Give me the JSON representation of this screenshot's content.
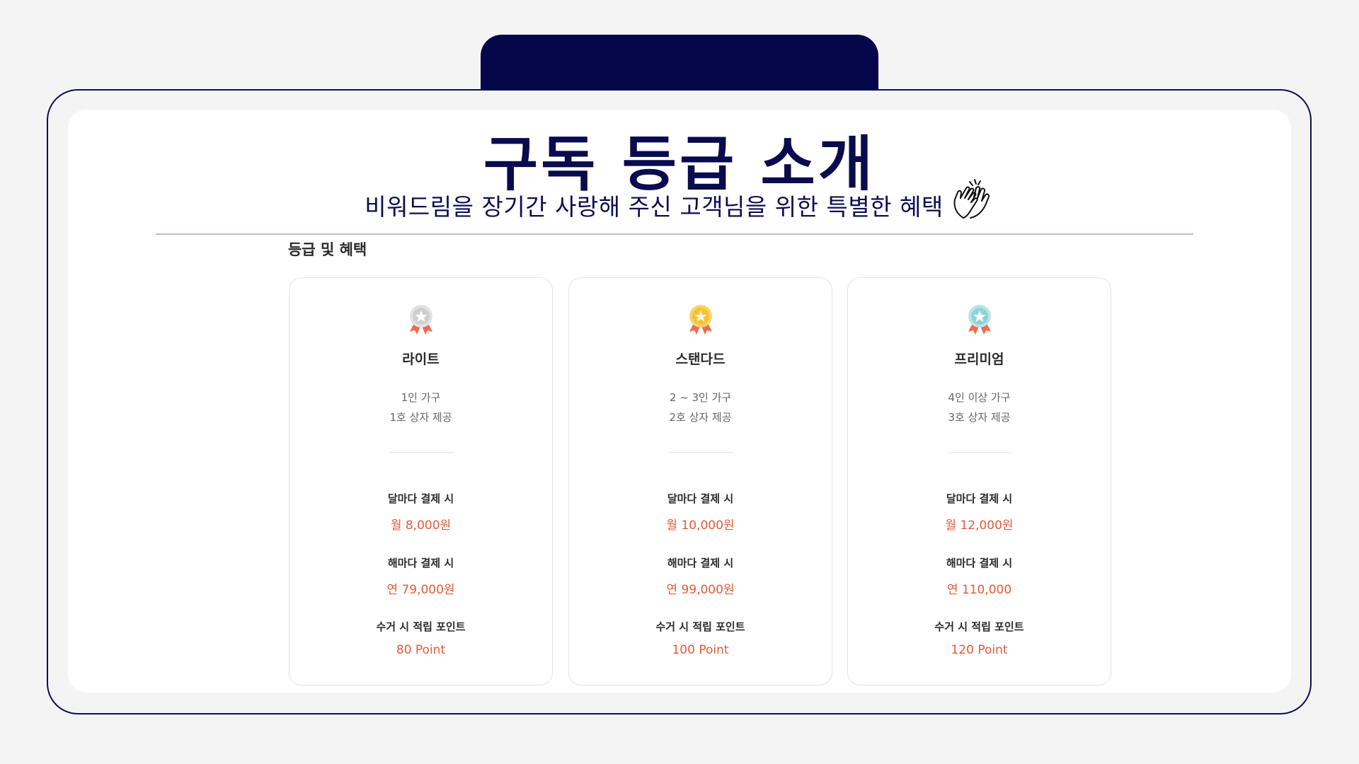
{
  "header": {
    "title": "구독 등급 소개",
    "subtitle": "비워드림을 장기간 사랑해 주신 고객님을 위한 특별한 혜택"
  },
  "section": {
    "title": "등급 및 혜택"
  },
  "colors": {
    "navy": "#0a0a4e",
    "accent_price": "#e45a3b",
    "medal_silver": "#cfcfcf",
    "medal_gold": "#f2c23a",
    "medal_teal": "#8fd3d6",
    "ribbon": "#f06a4f"
  },
  "cards": [
    {
      "icon": "silver-medal-icon",
      "name": "라이트",
      "desc1": "1인 가구",
      "desc2": "1호 상자 제공",
      "monthly_label": "달마다 결제 시",
      "monthly_price": "월 8,000원",
      "yearly_label": "해마다 결제 시",
      "yearly_price": "연 79,000원",
      "points_label": "수거 시 적립 포인트",
      "points": "80 Point"
    },
    {
      "icon": "gold-medal-icon",
      "name": "스탠다드",
      "desc1": "2 ~ 3인 가구",
      "desc2": "2호 상자 제공",
      "monthly_label": "달마다 결제 시",
      "monthly_price": "월 10,000원",
      "yearly_label": "해마다 결제 시",
      "yearly_price": "연 99,000원",
      "points_label": "수거 시 적립 포인트",
      "points": "100 Point"
    },
    {
      "icon": "teal-medal-icon",
      "name": "프리미엄",
      "desc1": "4인 이상 가구",
      "desc2": "3호 상자 제공",
      "monthly_label": "달마다 결제 시",
      "monthly_price": "월 12,000원",
      "yearly_label": "해마다 결제 시",
      "yearly_price": "연 110,000",
      "points_label": "수거 시 적립 포인트",
      "points": "120 Point"
    }
  ]
}
